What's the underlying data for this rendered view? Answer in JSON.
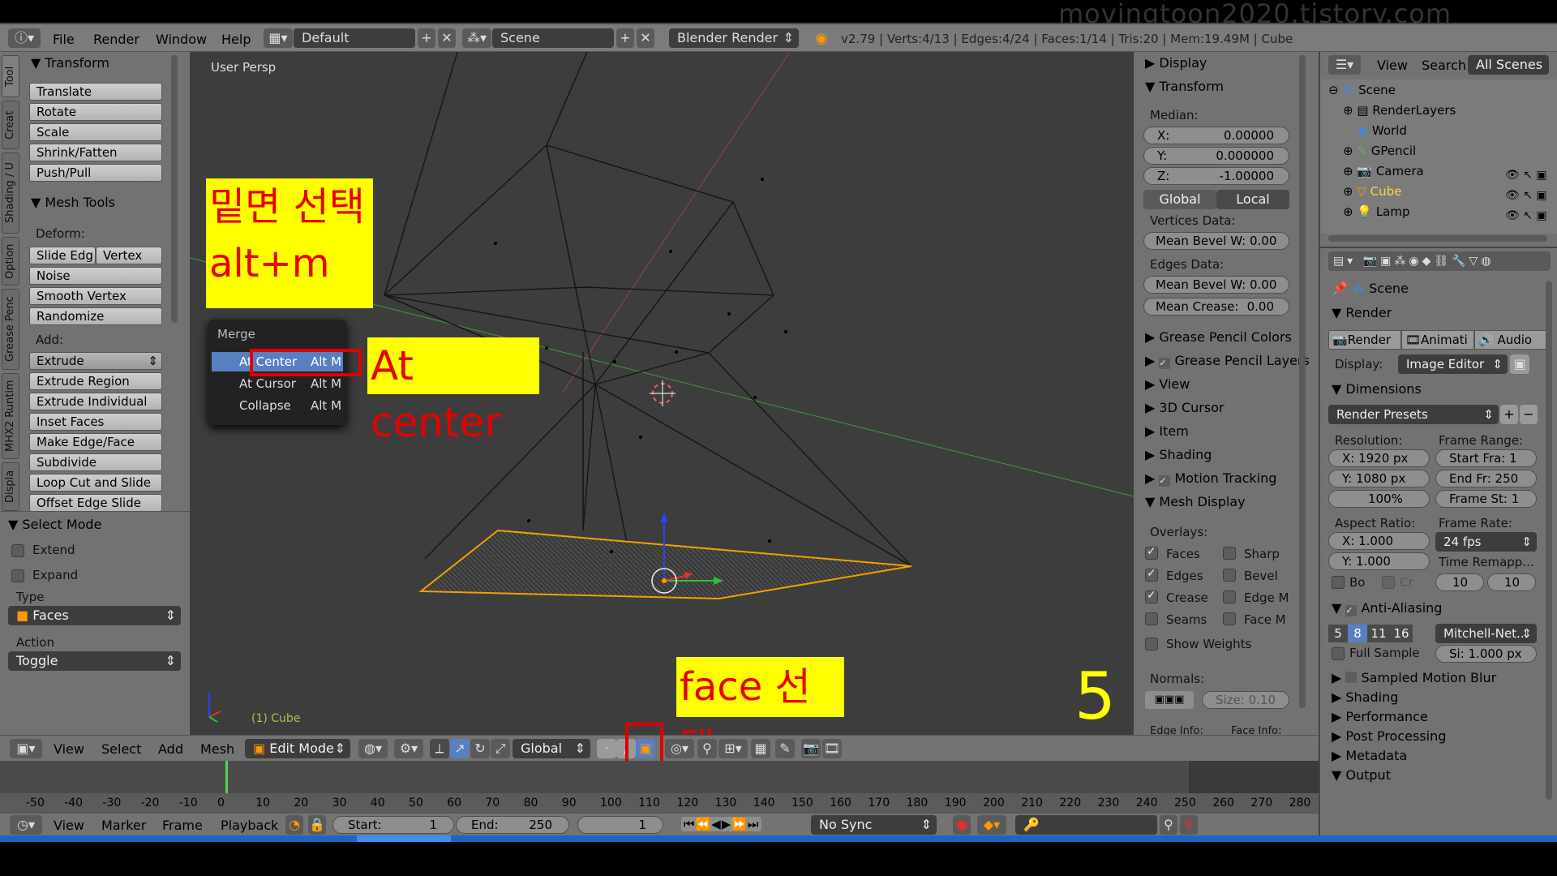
{
  "watermark": "movingtoon2020.tistory.com",
  "topbar": {
    "menus": [
      "File",
      "Render",
      "Window",
      "Help"
    ],
    "layout": "Default",
    "scene": "Scene",
    "engine": "Blender Render",
    "stats": "v2.79 | Verts:4/13 | Edges:4/24 | Faces:1/14 | Tris:20 | Mem:19.49M | Cube"
  },
  "toolshelf": {
    "tabs": [
      "Tool",
      "Creat",
      "Shading / U",
      "Option",
      "Grease Penc",
      "MHX2 Runtim",
      "Displa"
    ],
    "transform_title": "Transform",
    "transform_buttons": [
      "Translate",
      "Rotate",
      "Scale",
      "Shrink/Fatten",
      "Push/Pull"
    ],
    "mesh_tools_title": "Mesh Tools",
    "deform_label": "Deform:",
    "slide_edge": "Slide Edg",
    "vertex": "Vertex",
    "deform_buttons": [
      "Noise",
      "Smooth Vertex",
      "Randomize"
    ],
    "add_label": "Add:",
    "extrude": "Extrude",
    "add_buttons": [
      "Extrude Region",
      "Extrude Individual",
      "Inset Faces",
      "Make Edge/Face",
      "Subdivide",
      "Loop Cut and Slide",
      "Offset Edge Slide"
    ],
    "select_mode_title": "Select Mode",
    "extend": "Extend",
    "expand": "Expand",
    "type_label": "Type",
    "type_value": "Faces",
    "action_label": "Action",
    "action_value": "Toggle"
  },
  "viewport": {
    "view_label": "User Persp",
    "object_label": "(1) Cube",
    "merge_menu": {
      "title": "Merge",
      "items": [
        {
          "label": "At Center",
          "shortcut": "Alt M"
        },
        {
          "label": "At Cursor",
          "shortcut": "Alt M"
        },
        {
          "label": "Collapse",
          "shortcut": "Alt M"
        }
      ]
    },
    "annotation_bottom_select": "밑면 선택",
    "annotation_shortcut": "alt+m",
    "annotation_at_center": "At center",
    "annotation_face_select": "face 선택",
    "step_number": "5"
  },
  "properties_panel": {
    "display": "Display",
    "transform": "Transform",
    "median": "Median:",
    "x_label": "X:",
    "x_value": "0.00000",
    "y_label": "Y:",
    "y_value": "0.000000",
    "z_label": "Z:",
    "z_value": "-1.00000",
    "global": "Global",
    "local": "Local",
    "vertices_data": "Vertices Data:",
    "mean_bevel_v": "Mean Bevel W: 0.00",
    "edges_data": "Edges Data:",
    "mean_bevel_e": "Mean Bevel W: 0.00",
    "mean_crease": "Mean Crease:",
    "mean_crease_value": "0.00",
    "sections": [
      "Grease Pencil Colors",
      "Grease Pencil Layers",
      "View",
      "3D Cursor",
      "Item",
      "Shading",
      "Motion Tracking",
      "Mesh Display"
    ],
    "overlays": "Overlays:",
    "overlay_left": [
      "Faces",
      "Edges",
      "Crease",
      "Seams"
    ],
    "overlay_right": [
      "Sharp",
      "Bevel",
      "Edge M",
      "Face M"
    ],
    "show_weights": "Show Weights",
    "normals": "Normals:",
    "size": "Size: 0.10",
    "edge_info": "Edge Info:",
    "face_info": "Face Info:"
  },
  "viewport_header": {
    "menus": [
      "View",
      "Select",
      "Add",
      "Mesh"
    ],
    "mode": "Edit Mode",
    "orientation": "Global"
  },
  "timeline": {
    "ticks": [
      "-50",
      "-40",
      "-30",
      "-20",
      "-10",
      "0",
      "10",
      "20",
      "30",
      "40",
      "50",
      "60",
      "70",
      "80",
      "90",
      "100",
      "110",
      "120",
      "130",
      "140",
      "150",
      "160",
      "170",
      "180",
      "190",
      "200",
      "210",
      "220",
      "230",
      "240",
      "250",
      "260",
      "270",
      "280"
    ],
    "menus": [
      "View",
      "Marker",
      "Frame",
      "Playback"
    ],
    "start_label": "Start:",
    "start_value": "1",
    "end_label": "End:",
    "end_value": "250",
    "current": "1",
    "sync": "No Sync"
  },
  "outliner": {
    "view": "View",
    "search": "Search",
    "all_scenes": "All Scenes",
    "items": [
      "Scene",
      "RenderLayers",
      "World",
      "GPencil",
      "Camera",
      "Cube",
      "Lamp"
    ]
  },
  "render_props": {
    "scene": "Scene",
    "render_title": "Render",
    "render_btn": "Render",
    "anim_btn": "Animati",
    "audio_btn": "Audio",
    "display_label": "Display:",
    "display_value": "Image Editor",
    "dimensions": "Dimensions",
    "presets": "Render Presets",
    "resolution": "Resolution:",
    "res_x": "X:  1920 px",
    "res_y": "Y:  1080 px",
    "res_pct": "100%",
    "frame_range": "Frame Range:",
    "start_fr": "Start Fra:  1",
    "end_fr": "End Fr: 250",
    "frame_st": "Frame St: 1",
    "aspect": "Aspect Ratio:",
    "asp_x": "X:   1.000",
    "asp_y": "Y:   1.000",
    "frame_rate": "Frame Rate:",
    "fps": "24 fps",
    "time_remap": "Time Remapp...",
    "bo": "Bo",
    "cr": "Cr",
    "remap_old": "10",
    "remap_new": "10",
    "anti_aliasing": "Anti-Aliasing",
    "aa_samples": [
      "5",
      "8",
      "11",
      "16"
    ],
    "filter": "Mitchell-Net...",
    "full_sample": "Full Sample",
    "filter_size": "Si: 1.000 px",
    "sections": [
      "Sampled Motion Blur",
      "Shading",
      "Performance",
      "Post Processing",
      "Metadata",
      "Output"
    ]
  }
}
